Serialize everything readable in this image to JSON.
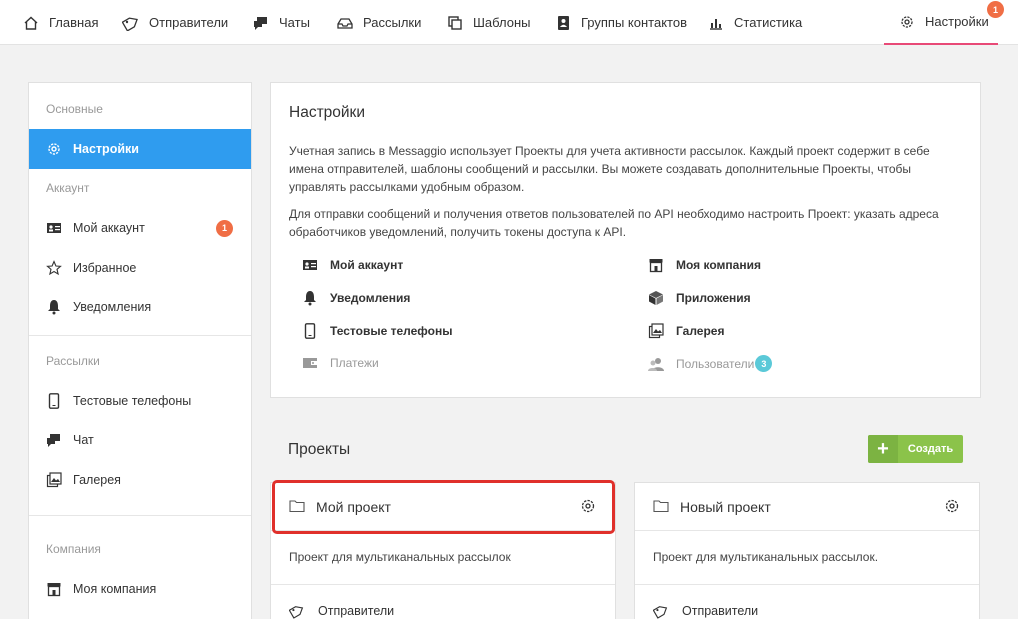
{
  "nav": {
    "items": [
      {
        "label": "Главная",
        "icon": "home-icon"
      },
      {
        "label": "Отправители",
        "icon": "tag-icon"
      },
      {
        "label": "Чаты",
        "icon": "chat-icon"
      },
      {
        "label": "Рассылки",
        "icon": "inbox-icon"
      },
      {
        "label": "Шаблоны",
        "icon": "copy-icon"
      },
      {
        "label": "Группы контактов",
        "icon": "contact-book-icon"
      },
      {
        "label": "Статистика",
        "icon": "bar-chart-icon"
      }
    ],
    "settings_label": "Настройки",
    "settings_badge": "1",
    "accent_color": "#e84a77"
  },
  "sidebar": {
    "section_basic": "Основные",
    "item_settings": "Настройки",
    "section_account": "Аккаунт",
    "item_my_account": "Мой аккаунт",
    "my_account_badge": "1",
    "item_favorites": "Избранное",
    "item_notifications": "Уведомления",
    "section_mailings": "Рассылки",
    "item_test_phones": "Тестовые телефоны",
    "item_chat": "Чат",
    "item_gallery": "Галерея",
    "section_company": "Компания",
    "item_my_company": "Моя компания",
    "active_color": "#2f9cef"
  },
  "settings": {
    "title": "Настройки",
    "para1_line1": "Учетная запись в Messaggio использует Проекты для учета активности рассылок. Каждый проект содержит в себе",
    "para1_line2": "имена отправителей, шаблоны сообщений и рассылки. Вы можете создавать дополнительные Проекты, чтобы",
    "para1_line3": "управлять рассылками удобным образом.",
    "para2_line1": "Для отправки сообщений и получения ответов пользователей по API необходимо настроить Проект: указать адреса",
    "para2_line2": "обработчиков уведомлений, получить токены доступа к API.",
    "link_my_account": "Мой аккаунт",
    "link_notifications": "Уведомления",
    "link_test_phones": "Тестовые телефоны",
    "link_payments": "Платежи",
    "link_my_company": "Моя компания",
    "link_apps": "Приложения",
    "link_gallery": "Галерея",
    "link_users": "Пользователи",
    "users_badge": "3"
  },
  "projects": {
    "title": "Проекты",
    "create_label": "Создать",
    "create_color": "#8bc34a",
    "items": [
      {
        "name": "Мой проект",
        "desc": "Проект для мультиканальных рассылок",
        "link": "Отправители"
      },
      {
        "name": "Новый проект",
        "desc": "Проект для мультиканальных рассылок.",
        "link": "Отправители"
      }
    ],
    "highlight_color": "#e0302b"
  }
}
